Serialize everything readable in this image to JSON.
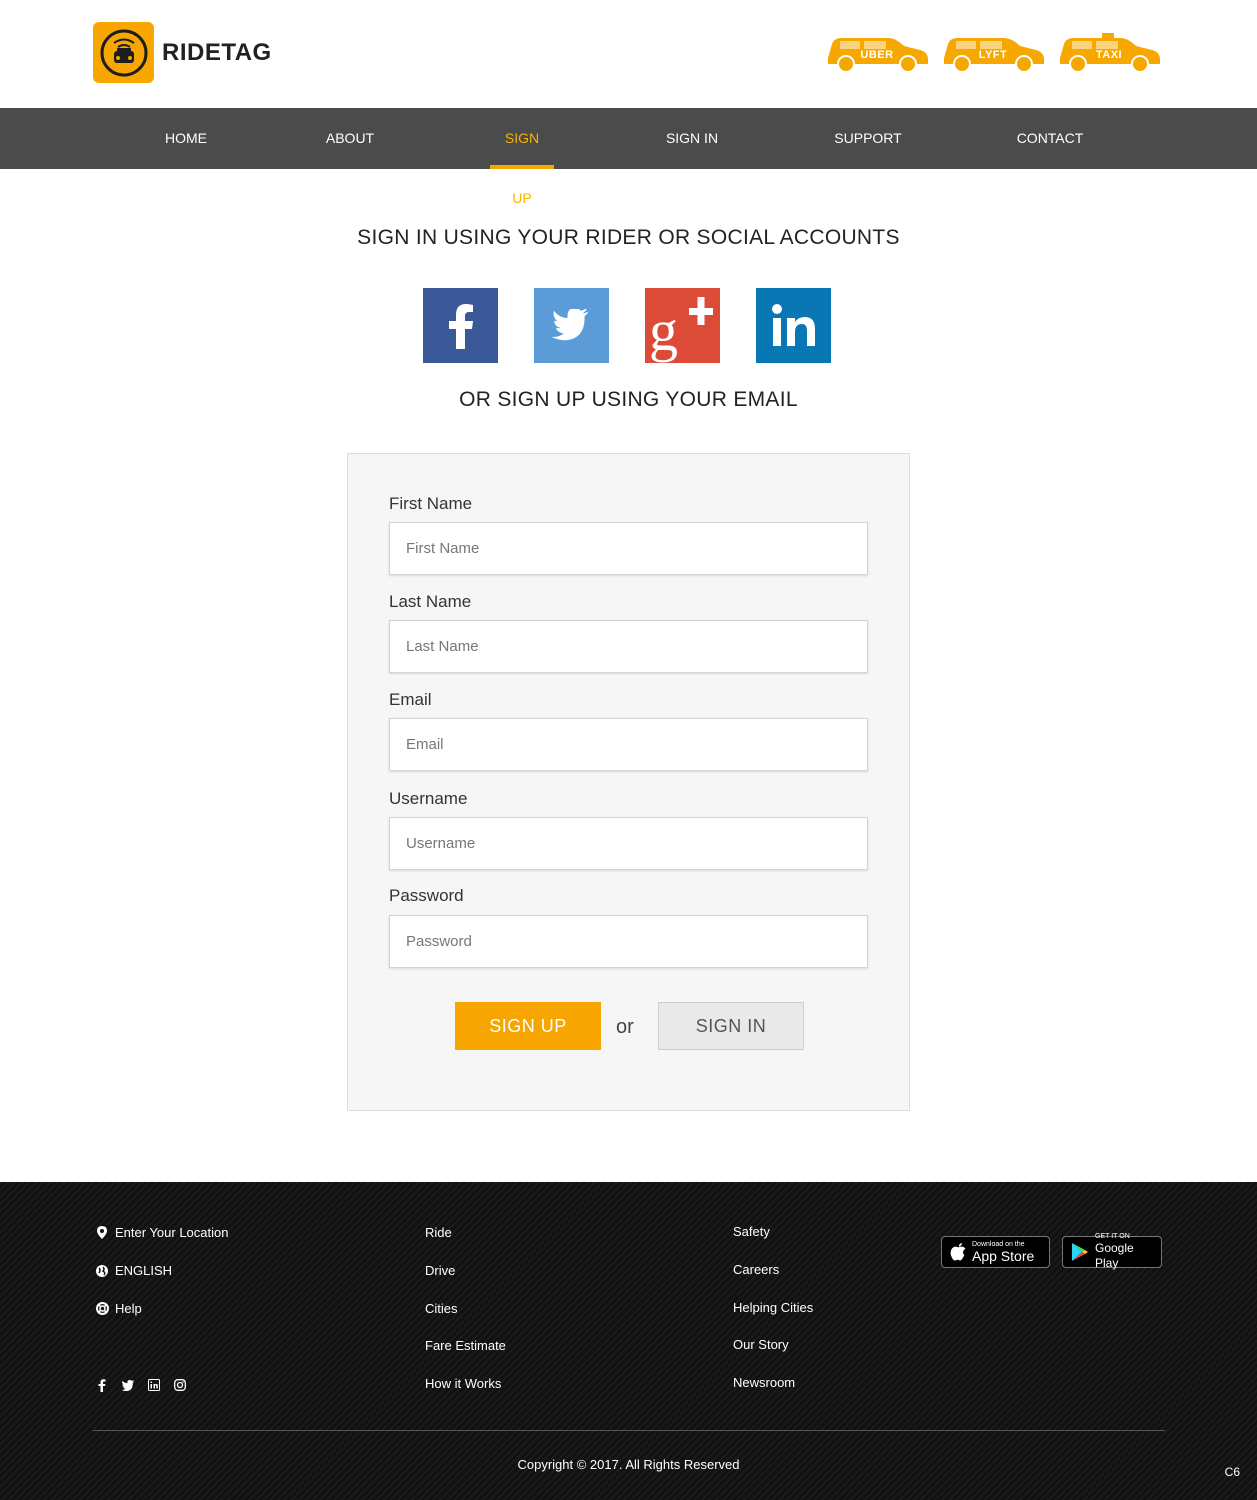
{
  "brand": {
    "name": "RIDETAG",
    "accent": "#f7a700"
  },
  "cars": [
    "UBER",
    "LYFT",
    "TAXI"
  ],
  "nav": {
    "items": [
      {
        "label": "HOME"
      },
      {
        "label": "ABOUT"
      },
      {
        "label": "SIGN UP",
        "active": true
      },
      {
        "label": "SIGN IN"
      },
      {
        "label": "SUPPORT"
      },
      {
        "label": "CONTACT"
      }
    ]
  },
  "page": {
    "heading_social": "SIGN IN USING YOUR RIDER OR SOCIAL ACCOUNTS",
    "socials": [
      "facebook-icon",
      "twitter-icon",
      "google-plus-icon",
      "linkedin-icon"
    ],
    "heading_email": "OR SIGN UP USING YOUR EMAIL"
  },
  "form": {
    "first_name": {
      "label": "First Name",
      "placeholder": "First Name"
    },
    "last_name": {
      "label": "Last Name",
      "placeholder": "Last Name"
    },
    "email": {
      "label": "Email",
      "placeholder": "Email"
    },
    "username": {
      "label": "Username",
      "placeholder": "Username"
    },
    "password": {
      "label": "Password",
      "placeholder": "Password"
    },
    "signup_label": "SIGN UP",
    "or_text": "or",
    "signin_label": "SIGN IN"
  },
  "footer": {
    "col1": [
      "Enter Your Location",
      "ENGLISH",
      "Help"
    ],
    "col2": [
      "Ride",
      "Drive",
      "Cities",
      "Fare Estimate",
      "How it Works"
    ],
    "col3": [
      "Safety",
      "Careers",
      "Helping Cities",
      "Our Story",
      "Newsroom"
    ],
    "appstore": {
      "small": "Download on the",
      "big": "App Store"
    },
    "googleplay": {
      "small": "GET IT ON",
      "big": "Google Play"
    },
    "copyright": "Copyright © 2017. All Rights Reserved",
    "corner": "C6"
  }
}
